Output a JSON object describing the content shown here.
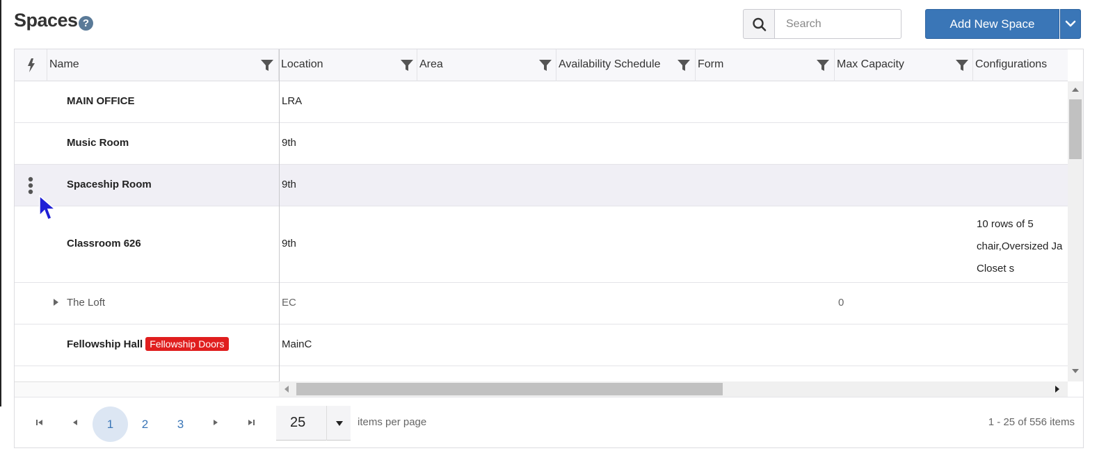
{
  "page": {
    "title": "Spaces",
    "help_icon": "question-circle-icon"
  },
  "toolbar": {
    "search_placeholder": "Search",
    "search_value": "",
    "add_button_label": "Add New Space"
  },
  "columns": [
    "Name",
    "Location",
    "Area",
    "Availability Schedule",
    "Form",
    "Max Capacity",
    "Configurations"
  ],
  "rows": [
    {
      "name": "MAIN OFFICE",
      "location": "LRA"
    },
    {
      "name": "Music Room",
      "location": "9th"
    },
    {
      "name": "Spaceship Room",
      "location": "9th"
    },
    {
      "name": "Classroom 626",
      "location": "9th",
      "configurations": [
        "10 rows of 5",
        "chair,Oversized Ja",
        "Closet s"
      ]
    },
    {
      "name": "The Loft",
      "location": "EC",
      "max_capacity": "0"
    },
    {
      "name": "Fellowship Hall",
      "tag": "Fellowship Doors",
      "location": "MainC"
    }
  ],
  "pager": {
    "pages": [
      "1",
      "2",
      "3"
    ],
    "current_page": "1",
    "page_size": "25",
    "page_size_label": "items per page",
    "range_text": "1 - 25 of 556 items"
  },
  "colors": {
    "accent": "#3a76b7",
    "tag_red": "#e01e1e",
    "hover_row": "#f0eff5"
  }
}
